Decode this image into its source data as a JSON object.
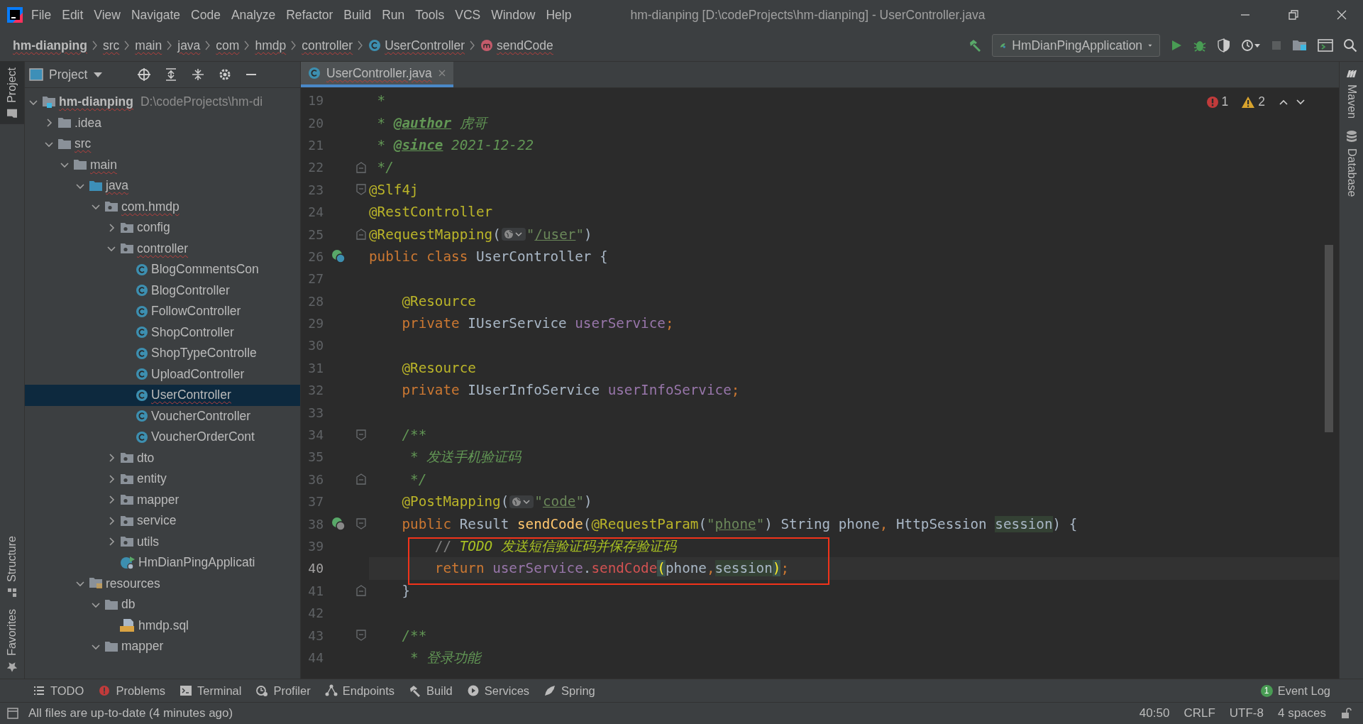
{
  "window": {
    "title": "hm-dianping [D:\\codeProjects\\hm-dianping] - UserController.java"
  },
  "menu": [
    "File",
    "Edit",
    "View",
    "Navigate",
    "Code",
    "Analyze",
    "Refactor",
    "Build",
    "Run",
    "Tools",
    "VCS",
    "Window",
    "Help"
  ],
  "breadcrumbs": [
    {
      "label": "hm-dianping",
      "kind": "project",
      "error": true
    },
    {
      "label": "src",
      "kind": "folder",
      "error": true
    },
    {
      "label": "main",
      "kind": "folder",
      "error": true
    },
    {
      "label": "java",
      "kind": "folder",
      "error": true
    },
    {
      "label": "com",
      "kind": "folder",
      "error": true
    },
    {
      "label": "hmdp",
      "kind": "folder",
      "error": true
    },
    {
      "label": "controller",
      "kind": "folder",
      "error": true
    },
    {
      "label": "UserController",
      "kind": "class",
      "error": true
    },
    {
      "label": "sendCode",
      "kind": "method",
      "error": true
    }
  ],
  "run_toolbar": {
    "run_config": "HmDianPingApplication",
    "stop_enabled": false
  },
  "left_strip": {
    "top": [
      {
        "label": "Project",
        "selected": true
      }
    ],
    "bottom": [
      {
        "label": "Structure",
        "selected": false
      },
      {
        "label": "Favorites",
        "selected": false
      }
    ]
  },
  "right_strip": [
    {
      "label": "Maven",
      "kind": "maven"
    },
    {
      "label": "Database",
      "kind": "database"
    }
  ],
  "project": {
    "title": "Project",
    "tree": [
      {
        "label": "hm-dianping",
        "kind": "module",
        "path": "D:\\codeProjects\\hm-di",
        "expanded": true,
        "selected": false,
        "error": true,
        "children": [
          {
            "label": ".idea",
            "kind": "folder",
            "expanded": false,
            "selected": false,
            "error": false
          },
          {
            "label": "src",
            "kind": "folder",
            "expanded": true,
            "selected": false,
            "error": true,
            "children": [
              {
                "label": "main",
                "kind": "folder",
                "expanded": true,
                "selected": false,
                "error": true,
                "children": [
                  {
                    "label": "java",
                    "kind": "source-root",
                    "expanded": true,
                    "selected": false,
                    "error": true,
                    "children": [
                      {
                        "label": "com.hmdp",
                        "kind": "package",
                        "expanded": true,
                        "selected": false,
                        "error": true,
                        "children": [
                          {
                            "label": "config",
                            "kind": "package",
                            "expanded": false,
                            "selected": false,
                            "error": false
                          },
                          {
                            "label": "controller",
                            "kind": "package",
                            "expanded": true,
                            "selected": false,
                            "error": true,
                            "children": [
                              {
                                "label": "BlogCommentsCon",
                                "kind": "class",
                                "selected": false,
                                "error": false
                              },
                              {
                                "label": "BlogController",
                                "kind": "class",
                                "selected": false,
                                "error": false
                              },
                              {
                                "label": "FollowController",
                                "kind": "class",
                                "selected": false,
                                "error": false
                              },
                              {
                                "label": "ShopController",
                                "kind": "class",
                                "selected": false,
                                "error": false
                              },
                              {
                                "label": "ShopTypeControlle",
                                "kind": "class",
                                "selected": false,
                                "error": false
                              },
                              {
                                "label": "UploadController",
                                "kind": "class",
                                "selected": false,
                                "error": false
                              },
                              {
                                "label": "UserController",
                                "kind": "class",
                                "selected": true,
                                "error": true
                              },
                              {
                                "label": "VoucherController",
                                "kind": "class",
                                "selected": false,
                                "error": false
                              },
                              {
                                "label": "VoucherOrderCont",
                                "kind": "class",
                                "selected": false,
                                "error": false
                              }
                            ]
                          },
                          {
                            "label": "dto",
                            "kind": "package",
                            "expanded": false,
                            "selected": false,
                            "error": false
                          },
                          {
                            "label": "entity",
                            "kind": "package",
                            "expanded": false,
                            "selected": false,
                            "error": false
                          },
                          {
                            "label": "mapper",
                            "kind": "package",
                            "expanded": false,
                            "selected": false,
                            "error": false
                          },
                          {
                            "label": "service",
                            "kind": "package",
                            "expanded": false,
                            "selected": false,
                            "error": false
                          },
                          {
                            "label": "utils",
                            "kind": "package",
                            "expanded": false,
                            "selected": false,
                            "error": false
                          },
                          {
                            "label": "HmDianPingApplicati",
                            "kind": "spring-app",
                            "selected": false,
                            "error": false
                          }
                        ]
                      }
                    ]
                  },
                  {
                    "label": "resources",
                    "kind": "resources-root",
                    "expanded": true,
                    "selected": false,
                    "error": false,
                    "children": [
                      {
                        "label": "db",
                        "kind": "folder",
                        "expanded": true,
                        "selected": false,
                        "error": false,
                        "children": [
                          {
                            "label": "hmdp.sql",
                            "kind": "sql",
                            "selected": false,
                            "error": false
                          }
                        ]
                      },
                      {
                        "label": "mapper",
                        "kind": "folder",
                        "expanded": true,
                        "selected": false,
                        "error": false
                      }
                    ]
                  }
                ]
              }
            ]
          }
        ]
      }
    ]
  },
  "editor": {
    "tabs": [
      {
        "label": "UserController.java",
        "selected": true,
        "error": true
      }
    ],
    "problems": {
      "errors": "1",
      "warnings": "2"
    },
    "lines": [
      {
        "number": "19",
        "current": false,
        "t": [
          {
            "text": " *",
            "kind": "doc"
          }
        ]
      },
      {
        "number": "20",
        "current": false,
        "t": [
          {
            "text": " * ",
            "kind": "doc"
          },
          {
            "text": "@author",
            "kind": "doc-tag"
          },
          {
            "text": " 虎哥",
            "kind": "doc"
          }
        ]
      },
      {
        "number": "21",
        "current": false,
        "t": [
          {
            "text": " * ",
            "kind": "doc"
          },
          {
            "text": "@since",
            "kind": "doc-tag"
          },
          {
            "text": " 2021-12-22",
            "kind": "doc"
          }
        ]
      },
      {
        "number": "22",
        "current": false,
        "fold_end": true,
        "t": [
          {
            "text": " */",
            "kind": "doc"
          }
        ]
      },
      {
        "number": "23",
        "current": false,
        "fold_start": true,
        "t": [
          {
            "text": "@Slf4j",
            "kind": "annotation"
          }
        ]
      },
      {
        "number": "24",
        "current": false,
        "t": [
          {
            "text": "@RestController",
            "kind": "annotation"
          }
        ]
      },
      {
        "number": "25",
        "current": false,
        "fold_end": true,
        "t": [
          {
            "text": "@RequestMapping",
            "kind": "annotation"
          },
          {
            "text": "(",
            "kind": "plain"
          },
          {
            "kind": "url-hint"
          },
          {
            "text": "\"",
            "kind": "string"
          },
          {
            "text": "/user",
            "kind": "url"
          },
          {
            "text": "\"",
            "kind": "string"
          },
          {
            "text": ")",
            "kind": "plain"
          }
        ]
      },
      {
        "number": "26",
        "current": false,
        "bean_marker": true,
        "t": [
          {
            "text": "public class ",
            "kind": "keyword"
          },
          {
            "text": "UserController {",
            "kind": "plain"
          }
        ]
      },
      {
        "number": "27",
        "current": false
      },
      {
        "number": "28",
        "current": false,
        "t": [
          {
            "text": "    @Resource",
            "kind": "annotation"
          }
        ]
      },
      {
        "number": "29",
        "current": false,
        "t": [
          {
            "text": "    private ",
            "kind": "keyword"
          },
          {
            "text": "IUserService ",
            "kind": "plain"
          },
          {
            "text": "userService",
            "kind": "field"
          },
          {
            "text": ";",
            "kind": "keyword"
          }
        ]
      },
      {
        "number": "30",
        "current": false
      },
      {
        "number": "31",
        "current": false,
        "t": [
          {
            "text": "    @Resource",
            "kind": "annotation"
          }
        ]
      },
      {
        "number": "32",
        "current": false,
        "t": [
          {
            "text": "    private ",
            "kind": "keyword"
          },
          {
            "text": "IUserInfoService ",
            "kind": "plain"
          },
          {
            "text": "userInfoService",
            "kind": "field"
          },
          {
            "text": ";",
            "kind": "keyword"
          }
        ]
      },
      {
        "number": "33",
        "current": false
      },
      {
        "number": "34",
        "current": false,
        "fold_start": true,
        "t": [
          {
            "text": "    /**",
            "kind": "doc"
          }
        ]
      },
      {
        "number": "35",
        "current": false,
        "t": [
          {
            "text": "     * 发送手机验证码",
            "kind": "doc"
          }
        ]
      },
      {
        "number": "36",
        "current": false,
        "fold_end": true,
        "t": [
          {
            "text": "     */",
            "kind": "doc"
          }
        ]
      },
      {
        "number": "37",
        "current": false,
        "t": [
          {
            "text": "    @PostMapping",
            "kind": "annotation"
          },
          {
            "text": "(",
            "kind": "plain"
          },
          {
            "kind": "url-hint"
          },
          {
            "text": "\"",
            "kind": "string"
          },
          {
            "text": "code",
            "kind": "url"
          },
          {
            "text": "\"",
            "kind": "string"
          },
          {
            "text": ")",
            "kind": "plain"
          }
        ]
      },
      {
        "number": "38",
        "current": false,
        "fold_start": true,
        "endpoint_marker": true,
        "t": [
          {
            "text": "    public ",
            "kind": "keyword"
          },
          {
            "text": "Result ",
            "kind": "plain"
          },
          {
            "text": "sendCode",
            "kind": "method"
          },
          {
            "text": "(",
            "kind": "plain"
          },
          {
            "text": "@RequestParam",
            "kind": "annotation"
          },
          {
            "text": "(",
            "kind": "plain"
          },
          {
            "text": "\"",
            "kind": "string"
          },
          {
            "text": "phone",
            "kind": "url"
          },
          {
            "text": "\"",
            "kind": "string"
          },
          {
            "text": ") String phone",
            "kind": "plain"
          },
          {
            "text": ", ",
            "kind": "keyword"
          },
          {
            "text": "HttpSession ",
            "kind": "plain"
          },
          {
            "text": "session",
            "kind": "param-hl"
          },
          {
            "text": ") {",
            "kind": "plain"
          }
        ]
      },
      {
        "number": "39",
        "current": false,
        "boxed": true,
        "t": [
          {
            "text": "        // ",
            "kind": "comment"
          },
          {
            "text": "TODO 发送短信验证码并保存验证码",
            "kind": "todo"
          }
        ]
      },
      {
        "number": "40",
        "current": true,
        "boxed": true,
        "t": [
          {
            "text": "        return ",
            "kind": "keyword"
          },
          {
            "text": "userService",
            "kind": "field"
          },
          {
            "text": ".",
            "kind": "plain"
          },
          {
            "text": "sendCode",
            "kind": "call-error"
          },
          {
            "text": "(",
            "kind": "paren-match"
          },
          {
            "text": "phone",
            "kind": "plain"
          },
          {
            "text": ",",
            "kind": "keyword"
          },
          {
            "text": "session",
            "kind": "param-hl"
          },
          {
            "text": ")",
            "kind": "paren-match"
          },
          {
            "text": ";",
            "kind": "keyword"
          }
        ]
      },
      {
        "number": "41",
        "current": false,
        "fold_end": true,
        "t": [
          {
            "text": "    }",
            "kind": "plain"
          }
        ]
      },
      {
        "number": "42",
        "current": false
      },
      {
        "number": "43",
        "current": false,
        "fold_start": true,
        "t": [
          {
            "text": "    /**",
            "kind": "doc"
          }
        ]
      },
      {
        "number": "44",
        "current": false,
        "t": [
          {
            "text": "     * 登录功能",
            "kind": "doc"
          }
        ]
      }
    ]
  },
  "tool_windows": [
    {
      "label": "TODO",
      "kind": "todo"
    },
    {
      "label": "Problems",
      "kind": "problems"
    },
    {
      "label": "Terminal",
      "kind": "terminal"
    },
    {
      "label": "Profiler",
      "kind": "profiler"
    },
    {
      "label": "Endpoints",
      "kind": "endpoints"
    },
    {
      "label": "Build",
      "kind": "build"
    },
    {
      "label": "Services",
      "kind": "services"
    },
    {
      "label": "Spring",
      "kind": "spring"
    }
  ],
  "event_log": {
    "label": "Event Log",
    "count": "1"
  },
  "status_bar": {
    "message": "All files are up-to-date (4 minutes ago)",
    "items": [
      "40:50",
      "CRLF",
      "UTF-8",
      "4 spaces"
    ]
  }
}
